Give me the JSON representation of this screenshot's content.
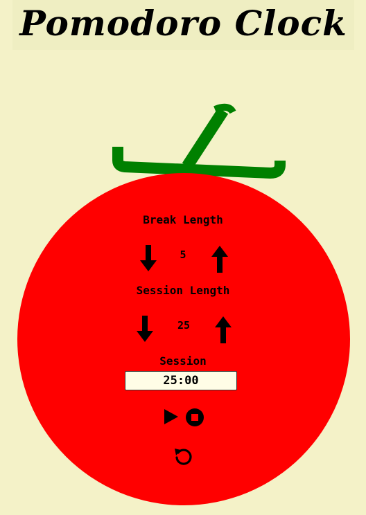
{
  "header": {
    "title": "Pomodoro Clock"
  },
  "break_control": {
    "label": "Break Length",
    "value": "5",
    "decrement_icon": "arrow-down-icon",
    "increment_icon": "arrow-up-icon"
  },
  "session_control": {
    "label": "Session Length",
    "value": "25",
    "decrement_icon": "arrow-down-icon",
    "increment_icon": "arrow-up-icon"
  },
  "timer": {
    "label": "Session",
    "time_left": "25:00"
  },
  "controls": {
    "play_icon": "play-icon",
    "stop_icon": "stop-icon",
    "reset_icon": "reset-icon"
  },
  "colors": {
    "background": "#f4f2c8",
    "tomato": "#ff0000",
    "stem": "#008000",
    "timer_background": "#fffde6"
  }
}
